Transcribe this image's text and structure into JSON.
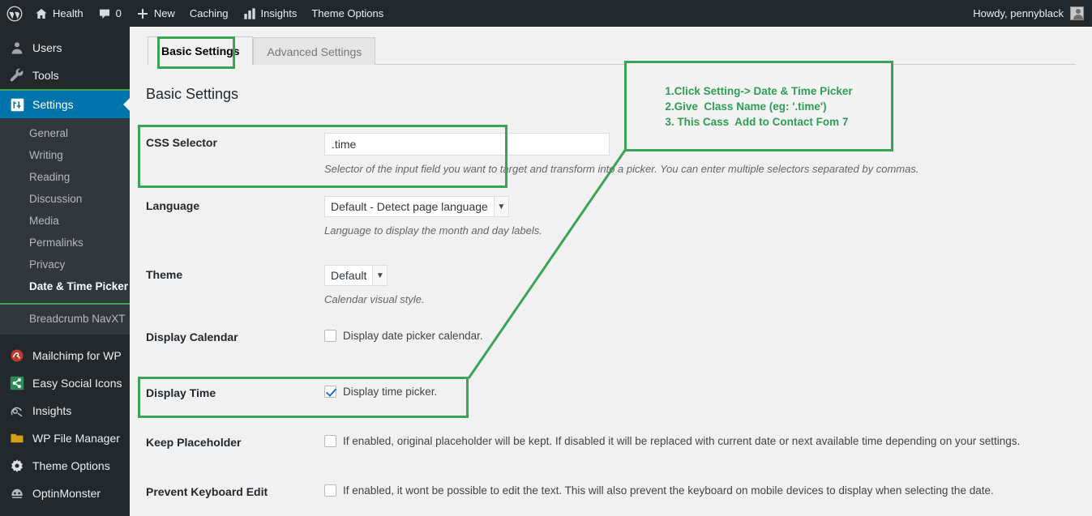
{
  "adminbar": {
    "items": [
      {
        "icon": "wordpress-logo-icon",
        "label": ""
      },
      {
        "icon": "home-icon",
        "label": "Health"
      },
      {
        "icon": "comment-icon",
        "label": "0"
      },
      {
        "icon": "plus-icon",
        "label": "New"
      },
      {
        "icon": "",
        "label": "Caching"
      },
      {
        "icon": "bar-chart-icon",
        "label": "Insights"
      },
      {
        "icon": "",
        "label": "Theme Options"
      }
    ],
    "howdy": "Howdy, pennyblack",
    "avatar_icon": "user-avatar-icon"
  },
  "sidebar": {
    "items": [
      {
        "label": "Users",
        "icon": "user-icon"
      },
      {
        "label": "Tools",
        "icon": "wrench-icon"
      },
      {
        "label": "Settings",
        "icon": "settings-sliders-icon",
        "current": true
      }
    ],
    "submenu": [
      {
        "label": "General"
      },
      {
        "label": "Writing"
      },
      {
        "label": "Reading"
      },
      {
        "label": "Discussion"
      },
      {
        "label": "Media"
      },
      {
        "label": "Permalinks"
      },
      {
        "label": "Privacy"
      },
      {
        "label": "Date & Time Picker",
        "active": true
      },
      {
        "label": "Breadcrumb NavXT"
      }
    ],
    "plugins": [
      {
        "label": "Mailchimp for WP",
        "icon": "mailchimp-icon",
        "color": "#c0392b"
      },
      {
        "label": "Easy Social Icons",
        "icon": "share-icon",
        "color": "#2e8b57"
      },
      {
        "label": "Insights",
        "icon": "insights-icon",
        "color": "#b4b9be"
      },
      {
        "label": "WP File Manager",
        "icon": "folder-icon",
        "color": "#d4a017"
      },
      {
        "label": "Theme Options",
        "icon": "gear-icon",
        "color": "#e0e0e0"
      },
      {
        "label": "OptinMonster",
        "icon": "optinmonster-icon",
        "color": "#b4b9be"
      }
    ]
  },
  "tabs": [
    {
      "label": "Basic Settings",
      "active": true
    },
    {
      "label": "Advanced Settings",
      "active": false
    }
  ],
  "page_title": "Basic Settings",
  "fields": {
    "css_selector": {
      "label": "CSS Selector",
      "value": ".time",
      "help": "Selector of the input field you want to target and transform into a picker. You can enter multiple selectors separated by commas."
    },
    "language": {
      "label": "Language",
      "value": "Default - Detect page language",
      "help": "Language to display the month and day labels."
    },
    "theme": {
      "label": "Theme",
      "value": "Default",
      "help": "Calendar visual style."
    },
    "display_calendar": {
      "label": "Display Calendar",
      "checkbox_label": "Display date picker calendar.",
      "checked": false
    },
    "display_time": {
      "label": "Display Time",
      "checkbox_label": "Display time picker.",
      "checked": true
    },
    "keep_placeholder": {
      "label": "Keep Placeholder",
      "checkbox_label": "If enabled, original placeholder will be kept. If disabled it will be replaced with current date or next available time depending on your settings.",
      "checked": false
    },
    "prevent_keyboard_edit": {
      "label": "Prevent Keyboard Edit",
      "checkbox_label": "If enabled, it wont be possible to edit the text. This will also prevent the keyboard on mobile devices to display when selecting the date.",
      "checked": false
    }
  },
  "annotation": {
    "text": "1.Click Setting-> Date & Time Picker\n2.Give  Class Name (eg: '.time')\n3. This Cass  Add to Contact Fom 7",
    "color": "#2e9e52",
    "border_color": "#3aa355"
  }
}
